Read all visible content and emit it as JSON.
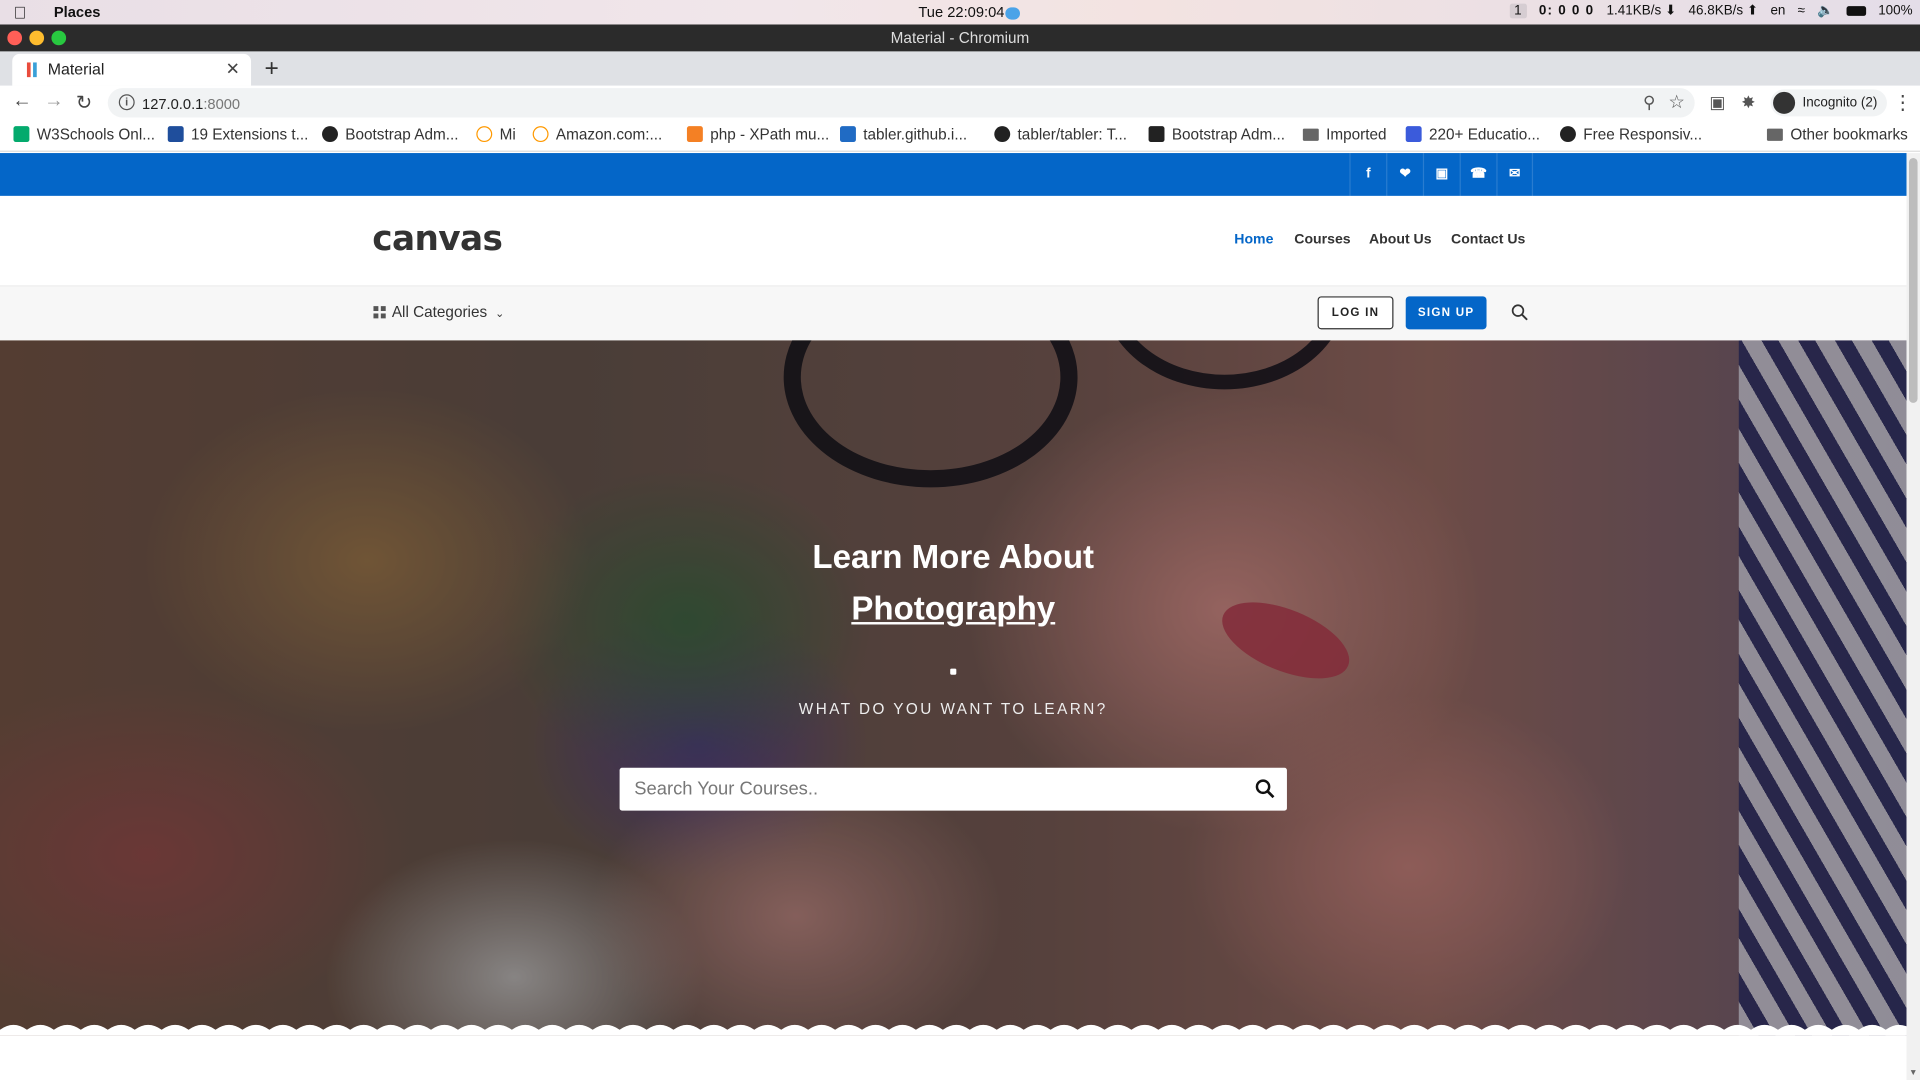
{
  "os": {
    "app_name": "Places",
    "clock": "Tue 22:09:04",
    "workspace": "1",
    "timer": "0: 0 0 0",
    "net_down": "1.41KB/s",
    "net_up": "46.8KB/s",
    "lang": "en",
    "battery": "100%"
  },
  "window": {
    "title": "Material - Chromium"
  },
  "browser": {
    "tab_title": "Material",
    "url_host": "127.0.0.1",
    "url_port": ":8000",
    "profile": "Incognito (2)",
    "bookmarks": [
      {
        "label": "W3Schools Onl...",
        "color": "#04aa6d"
      },
      {
        "label": "19 Extensions t...",
        "color": "#1f4e9c"
      },
      {
        "label": "Bootstrap Adm...",
        "color": "#222222"
      },
      {
        "label": "Mi",
        "color": "#ff9900"
      },
      {
        "label": "Amazon.com:...",
        "color": "#ff9900"
      },
      {
        "label": "php - XPath mu...",
        "color": "#f48024"
      },
      {
        "label": "tabler.github.i...",
        "color": "#206bc4"
      },
      {
        "label": "tabler/tabler: T...",
        "color": "#222222"
      },
      {
        "label": "Bootstrap Adm...",
        "color": "#222222"
      },
      {
        "label": "Imported",
        "color": "#666666"
      },
      {
        "label": "220+ Educatio...",
        "color": "#3b5bdb"
      },
      {
        "label": "Free Responsiv...",
        "color": "#222222"
      }
    ],
    "other_bookmarks": "Other bookmarks"
  },
  "site": {
    "brand_color": "#0466c8",
    "logo": "canvas",
    "social": [
      "facebook-icon",
      "twitter-icon",
      "instagram-icon",
      "phone-icon",
      "email-icon"
    ],
    "nav": {
      "home": "Home",
      "courses": "Courses",
      "about": "About Us",
      "contact": "Contact Us"
    },
    "categories": "All Categories",
    "login": "LOG IN",
    "signup": "SIGN UP",
    "hero": {
      "title_line1": "Learn More About",
      "title_line2": "Photography",
      "subtitle": "WHAT DO YOU WANT TO LEARN?",
      "search_placeholder": "Search Your Courses.."
    }
  }
}
